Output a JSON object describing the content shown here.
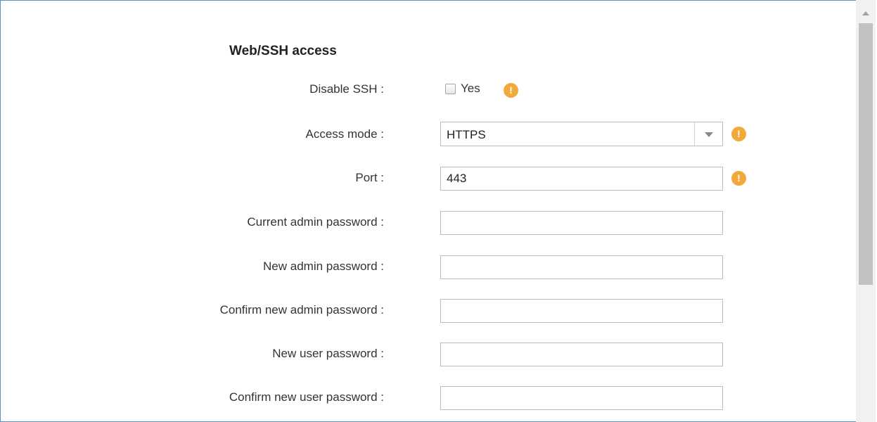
{
  "section": {
    "title": "Web/SSH access"
  },
  "fields": {
    "disable_ssh": {
      "label": "Disable SSH :",
      "option_label": "Yes",
      "checked": false
    },
    "access_mode": {
      "label": "Access mode :",
      "value": "HTTPS"
    },
    "port": {
      "label": "Port :",
      "value": "443"
    },
    "current_admin_password": {
      "label": "Current admin password :",
      "value": ""
    },
    "new_admin_password": {
      "label": "New admin password :",
      "value": ""
    },
    "confirm_new_admin_password": {
      "label": "Confirm new admin password :",
      "value": ""
    },
    "new_user_password": {
      "label": "New user password :",
      "value": ""
    },
    "confirm_new_user_password": {
      "label": "Confirm new user password :",
      "value": ""
    }
  },
  "icons": {
    "warning": "!",
    "warning_color": "#f2a93b"
  },
  "colors": {
    "frame_border": "#5b8fc7"
  }
}
